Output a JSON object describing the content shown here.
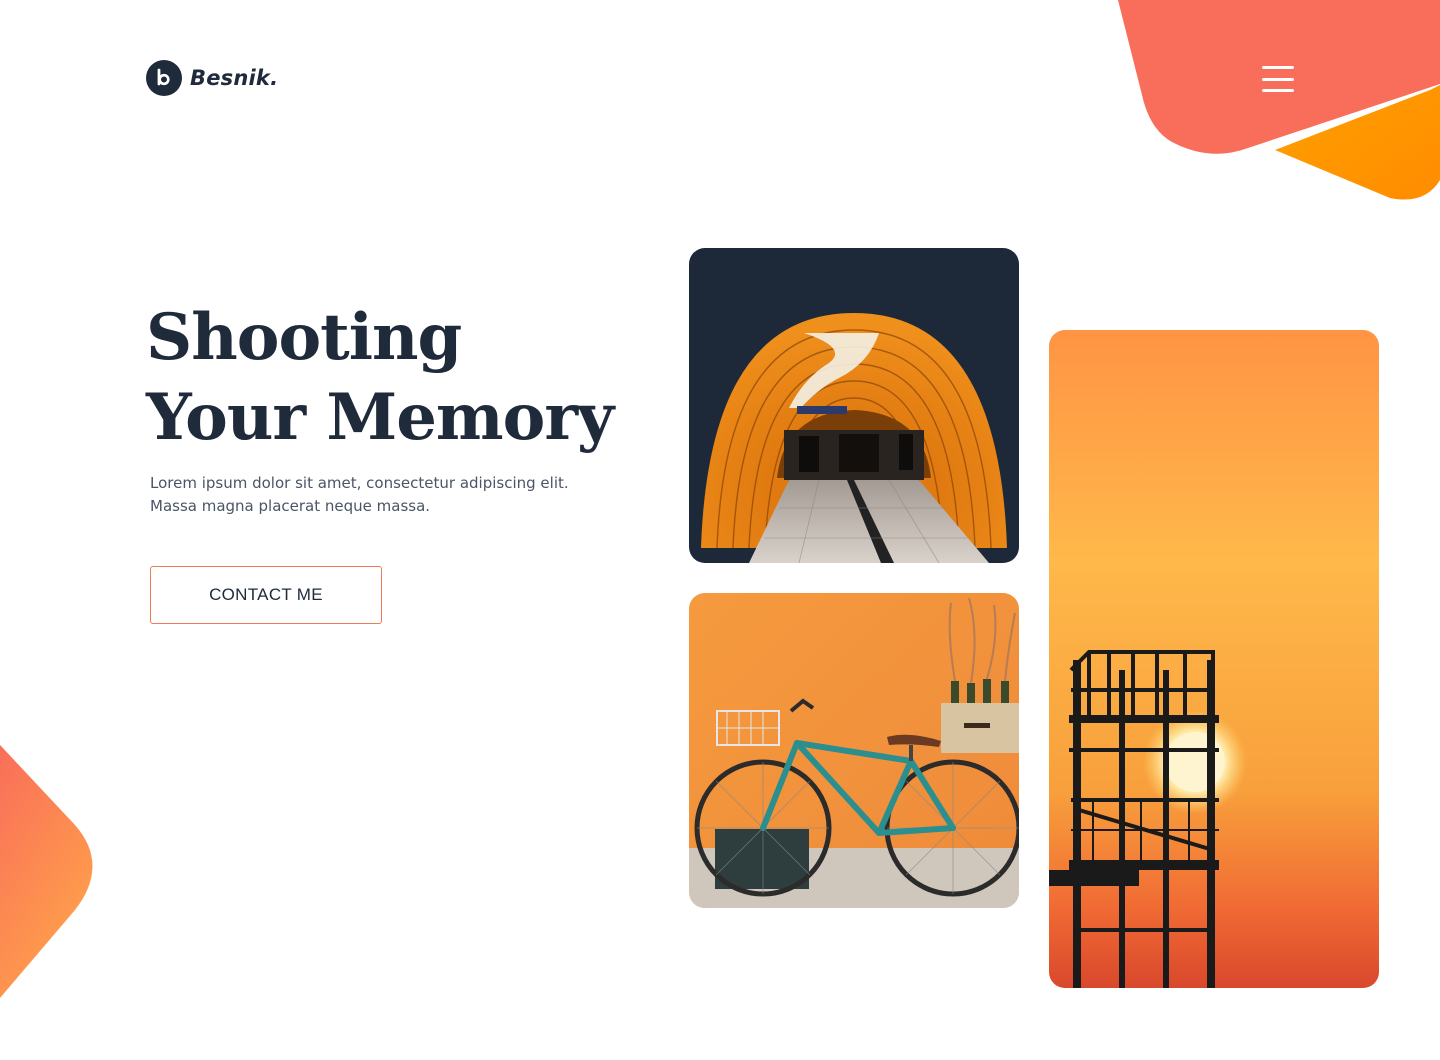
{
  "brand": {
    "name": "Besnik.",
    "logo_icon": "b-circle-logo-icon"
  },
  "header": {
    "menu_icon": "hamburger-menu-icon"
  },
  "hero": {
    "title_line1": "Shooting",
    "title_line2": "Your Memory",
    "description": "Lorem ipsum dolor sit amet, consectetur adipiscing elit. Massa magna placerat neque massa.",
    "cta_label": "CONTACT ME"
  },
  "gallery": {
    "photos": [
      {
        "subject": "orange-tunnel-photo"
      },
      {
        "subject": "teal-bicycle-photo"
      },
      {
        "subject": "sunset-tower-photo"
      }
    ]
  },
  "colors": {
    "navy": "#1f2a3a",
    "coral": "#f96e5a",
    "orange": "#ff9a00",
    "button_border": "#f07a55"
  }
}
